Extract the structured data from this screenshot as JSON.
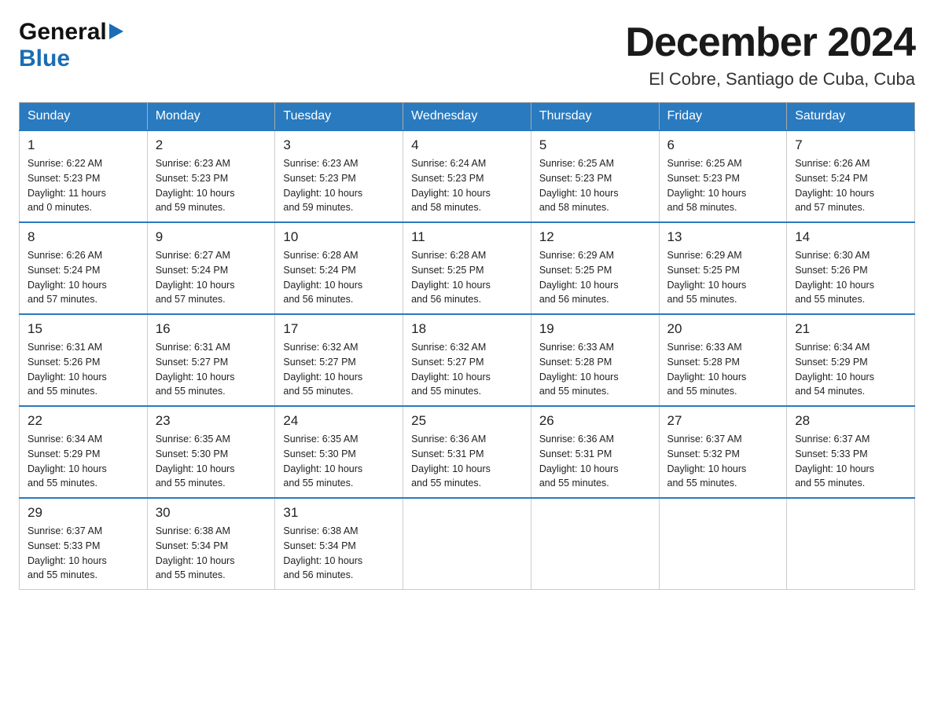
{
  "header": {
    "logo_general": "General",
    "logo_blue": "Blue",
    "title": "December 2024",
    "subtitle": "El Cobre, Santiago de Cuba, Cuba"
  },
  "weekdays": [
    "Sunday",
    "Monday",
    "Tuesday",
    "Wednesday",
    "Thursday",
    "Friday",
    "Saturday"
  ],
  "weeks": [
    [
      {
        "date": "1",
        "sunrise": "6:22 AM",
        "sunset": "5:23 PM",
        "daylight": "11 hours and 0 minutes."
      },
      {
        "date": "2",
        "sunrise": "6:23 AM",
        "sunset": "5:23 PM",
        "daylight": "10 hours and 59 minutes."
      },
      {
        "date": "3",
        "sunrise": "6:23 AM",
        "sunset": "5:23 PM",
        "daylight": "10 hours and 59 minutes."
      },
      {
        "date": "4",
        "sunrise": "6:24 AM",
        "sunset": "5:23 PM",
        "daylight": "10 hours and 58 minutes."
      },
      {
        "date": "5",
        "sunrise": "6:25 AM",
        "sunset": "5:23 PM",
        "daylight": "10 hours and 58 minutes."
      },
      {
        "date": "6",
        "sunrise": "6:25 AM",
        "sunset": "5:23 PM",
        "daylight": "10 hours and 58 minutes."
      },
      {
        "date": "7",
        "sunrise": "6:26 AM",
        "sunset": "5:24 PM",
        "daylight": "10 hours and 57 minutes."
      }
    ],
    [
      {
        "date": "8",
        "sunrise": "6:26 AM",
        "sunset": "5:24 PM",
        "daylight": "10 hours and 57 minutes."
      },
      {
        "date": "9",
        "sunrise": "6:27 AM",
        "sunset": "5:24 PM",
        "daylight": "10 hours and 57 minutes."
      },
      {
        "date": "10",
        "sunrise": "6:28 AM",
        "sunset": "5:24 PM",
        "daylight": "10 hours and 56 minutes."
      },
      {
        "date": "11",
        "sunrise": "6:28 AM",
        "sunset": "5:25 PM",
        "daylight": "10 hours and 56 minutes."
      },
      {
        "date": "12",
        "sunrise": "6:29 AM",
        "sunset": "5:25 PM",
        "daylight": "10 hours and 56 minutes."
      },
      {
        "date": "13",
        "sunrise": "6:29 AM",
        "sunset": "5:25 PM",
        "daylight": "10 hours and 55 minutes."
      },
      {
        "date": "14",
        "sunrise": "6:30 AM",
        "sunset": "5:26 PM",
        "daylight": "10 hours and 55 minutes."
      }
    ],
    [
      {
        "date": "15",
        "sunrise": "6:31 AM",
        "sunset": "5:26 PM",
        "daylight": "10 hours and 55 minutes."
      },
      {
        "date": "16",
        "sunrise": "6:31 AM",
        "sunset": "5:27 PM",
        "daylight": "10 hours and 55 minutes."
      },
      {
        "date": "17",
        "sunrise": "6:32 AM",
        "sunset": "5:27 PM",
        "daylight": "10 hours and 55 minutes."
      },
      {
        "date": "18",
        "sunrise": "6:32 AM",
        "sunset": "5:27 PM",
        "daylight": "10 hours and 55 minutes."
      },
      {
        "date": "19",
        "sunrise": "6:33 AM",
        "sunset": "5:28 PM",
        "daylight": "10 hours and 55 minutes."
      },
      {
        "date": "20",
        "sunrise": "6:33 AM",
        "sunset": "5:28 PM",
        "daylight": "10 hours and 55 minutes."
      },
      {
        "date": "21",
        "sunrise": "6:34 AM",
        "sunset": "5:29 PM",
        "daylight": "10 hours and 54 minutes."
      }
    ],
    [
      {
        "date": "22",
        "sunrise": "6:34 AM",
        "sunset": "5:29 PM",
        "daylight": "10 hours and 55 minutes."
      },
      {
        "date": "23",
        "sunrise": "6:35 AM",
        "sunset": "5:30 PM",
        "daylight": "10 hours and 55 minutes."
      },
      {
        "date": "24",
        "sunrise": "6:35 AM",
        "sunset": "5:30 PM",
        "daylight": "10 hours and 55 minutes."
      },
      {
        "date": "25",
        "sunrise": "6:36 AM",
        "sunset": "5:31 PM",
        "daylight": "10 hours and 55 minutes."
      },
      {
        "date": "26",
        "sunrise": "6:36 AM",
        "sunset": "5:31 PM",
        "daylight": "10 hours and 55 minutes."
      },
      {
        "date": "27",
        "sunrise": "6:37 AM",
        "sunset": "5:32 PM",
        "daylight": "10 hours and 55 minutes."
      },
      {
        "date": "28",
        "sunrise": "6:37 AM",
        "sunset": "5:33 PM",
        "daylight": "10 hours and 55 minutes."
      }
    ],
    [
      {
        "date": "29",
        "sunrise": "6:37 AM",
        "sunset": "5:33 PM",
        "daylight": "10 hours and 55 minutes."
      },
      {
        "date": "30",
        "sunrise": "6:38 AM",
        "sunset": "5:34 PM",
        "daylight": "10 hours and 55 minutes."
      },
      {
        "date": "31",
        "sunrise": "6:38 AM",
        "sunset": "5:34 PM",
        "daylight": "10 hours and 56 minutes."
      },
      null,
      null,
      null,
      null
    ]
  ]
}
